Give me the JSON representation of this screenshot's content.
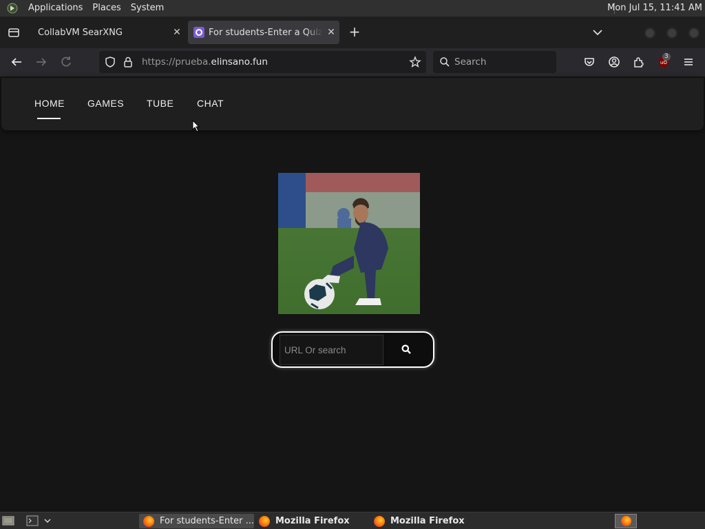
{
  "top_panel": {
    "menus": [
      "Applications",
      "Places",
      "System"
    ],
    "clock": "Mon Jul 15, 11:41 AM"
  },
  "tabs": [
    {
      "title": "CollabVM SearXNG",
      "active": false
    },
    {
      "title": "For students-Enter a Quiziz",
      "active": true
    }
  ],
  "navbar": {
    "url_prefix": "https://prueba.",
    "url_host": "elinsano.fun",
    "search_placeholder": "Search",
    "extension_badge": "3"
  },
  "site": {
    "nav": [
      "HOME",
      "GAMES",
      "TUBE",
      "CHAT"
    ],
    "active_nav": "HOME",
    "search_placeholder": "URL Or search"
  },
  "taskbar": {
    "tasks": [
      {
        "label": "For students-Enter ...",
        "active": true
      },
      {
        "label": "Mozilla Firefox",
        "active": false
      },
      {
        "label": "Mozilla Firefox",
        "active": false
      }
    ]
  }
}
